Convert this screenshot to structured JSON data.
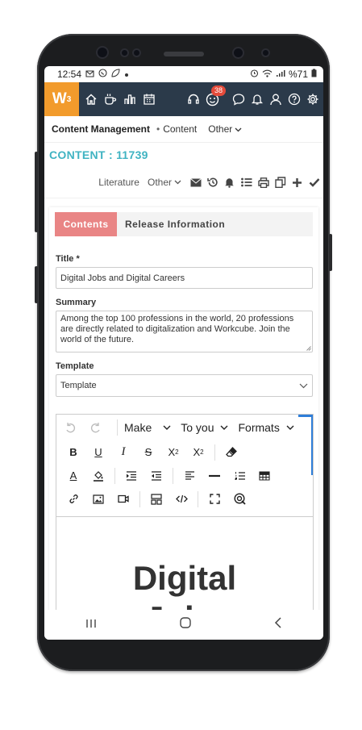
{
  "status": {
    "time": "12:54",
    "battery": "%71"
  },
  "app": {
    "logo": "W",
    "logo_sup": "3",
    "notifications_count": "38"
  },
  "breadcrumb": {
    "module": "Content Management",
    "page": "Content",
    "other": "Other"
  },
  "record": {
    "title": "CONTENT : 11739"
  },
  "actions": {
    "literature": "Literature",
    "other": "Other"
  },
  "tabs": {
    "active": "Contents",
    "second": "Release Information"
  },
  "form": {
    "title_label": "Title *",
    "title_value": "Digital Jobs and Digital Careers",
    "summary_label": "Summary",
    "summary_value": "Among the top 100 professions in the world, 20 professions are directly related to digitalization and Workcube. Join the world of the future.",
    "template_label": "Template",
    "template_value": "Template"
  },
  "editor": {
    "make": "Make",
    "to_you": "To you",
    "formats": "Formats",
    "content_line1": "Digital",
    "content_line2": "Jobs"
  },
  "colors": {
    "accent": "#f29b2c",
    "nav_bg": "#2b3a4a",
    "id_color": "#3fb3c2",
    "tab_active": "#e98585",
    "badge": "#e44b3b"
  }
}
